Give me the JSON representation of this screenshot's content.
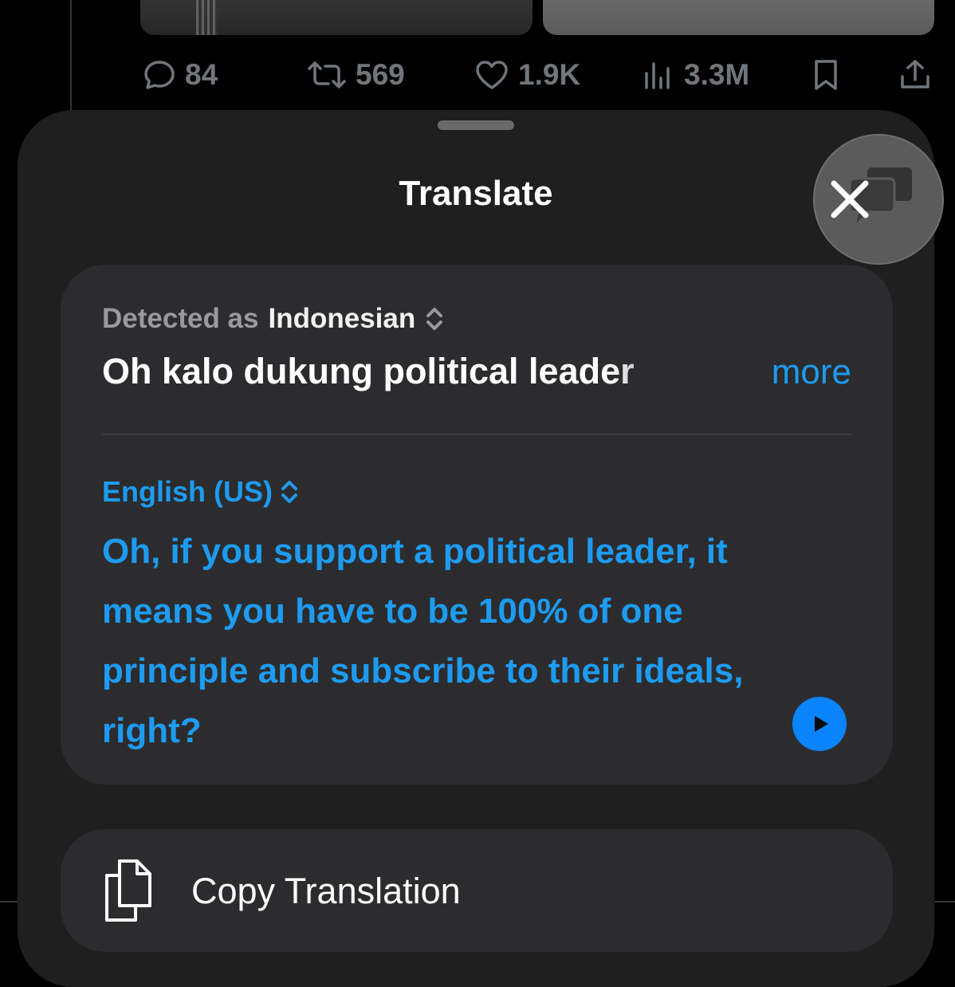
{
  "tweet_actions": {
    "replies": "84",
    "reposts": "569",
    "likes": "1.9K",
    "views": "3.3M"
  },
  "sheet": {
    "title": "Translate"
  },
  "translation": {
    "detected_label": "Detected as",
    "source_language": "Indonesian",
    "source_text": "Oh kalo dukung political leader",
    "more_label": "more",
    "target_language": "English (US)",
    "target_text": "Oh, if you support a political leader, it means you have to be 100% of one principle and subscribe to their ideals, right?"
  },
  "actions": {
    "copy_label": "Copy Translation"
  },
  "colors": {
    "accent": "#1d9bf0",
    "play_button": "#0a84ff",
    "sheet_bg": "#1f1f1f",
    "card_bg": "#2c2c2e"
  }
}
